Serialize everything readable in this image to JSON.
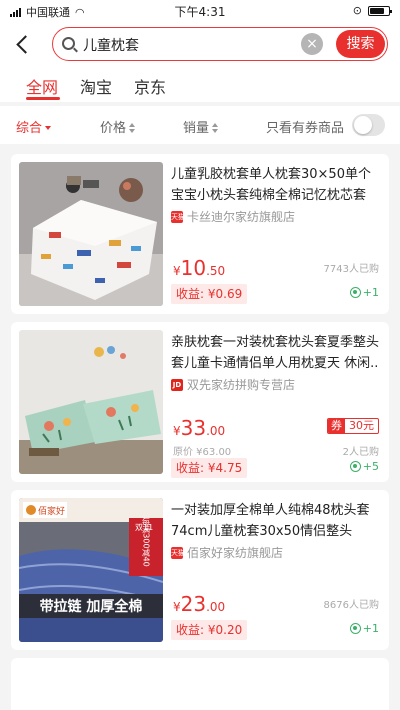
{
  "status_bar": {
    "carrier": "中国联通",
    "time": "下午4:31",
    "battery_level": 0.8
  },
  "search": {
    "query": "儿童枕套",
    "button_label": "搜索"
  },
  "platform_tabs": [
    {
      "label": "全网",
      "active": true
    },
    {
      "label": "淘宝",
      "active": false
    },
    {
      "label": "京东",
      "active": false
    }
  ],
  "sort_bar": {
    "comprehensive": "综合",
    "price": "价格",
    "sales": "销量",
    "coupon_only": "只看有券商品"
  },
  "products": [
    {
      "title": "儿童乳胶枕套单人枕套30×50单个宝宝小枕头套纯棉全棉记忆枕芯套",
      "shop_badge": "天猫",
      "shop": "卡丝迪尔家纺旗舰店",
      "currency": "¥",
      "price_int": "10",
      "price_dec": ".50",
      "sold": "7743人已购",
      "earn": "收益: ¥0.69",
      "plus": "+1"
    },
    {
      "title": "亲肤枕套一对装枕套枕头套夏季整头套儿童卡通情侣单人用枕夏天 休闲..",
      "shop_badge": "JD",
      "shop": "双先家纺拼购专营店",
      "currency": "¥",
      "price_int": "33",
      "price_dec": ".00",
      "coupon_tag": "券",
      "coupon_amount": "30元",
      "original_price": "原价 ¥63.00",
      "sold": "2人已购",
      "earn": "收益: ¥4.75",
      "plus": "+5"
    },
    {
      "title": "一对装加厚全棉单人纯棉48枕头套74cm儿童枕套30x50情侣整头40x60",
      "shop_badge": "天猫",
      "shop": "佰家好家纺旗舰店",
      "currency": "¥",
      "price_int": "23",
      "price_dec": ".00",
      "sold": "8676人已购",
      "earn": "收益: ¥0.20",
      "plus": "+1",
      "image_brand": "佰家好",
      "image_caption": "带拉链 加厚全棉",
      "image_promo": "每满300减40",
      "image_promo_tag": "双11"
    }
  ],
  "colors": {
    "accent": "#e8312f",
    "earn_bg": "#fde9e7",
    "plus_green": "#3bb069"
  }
}
